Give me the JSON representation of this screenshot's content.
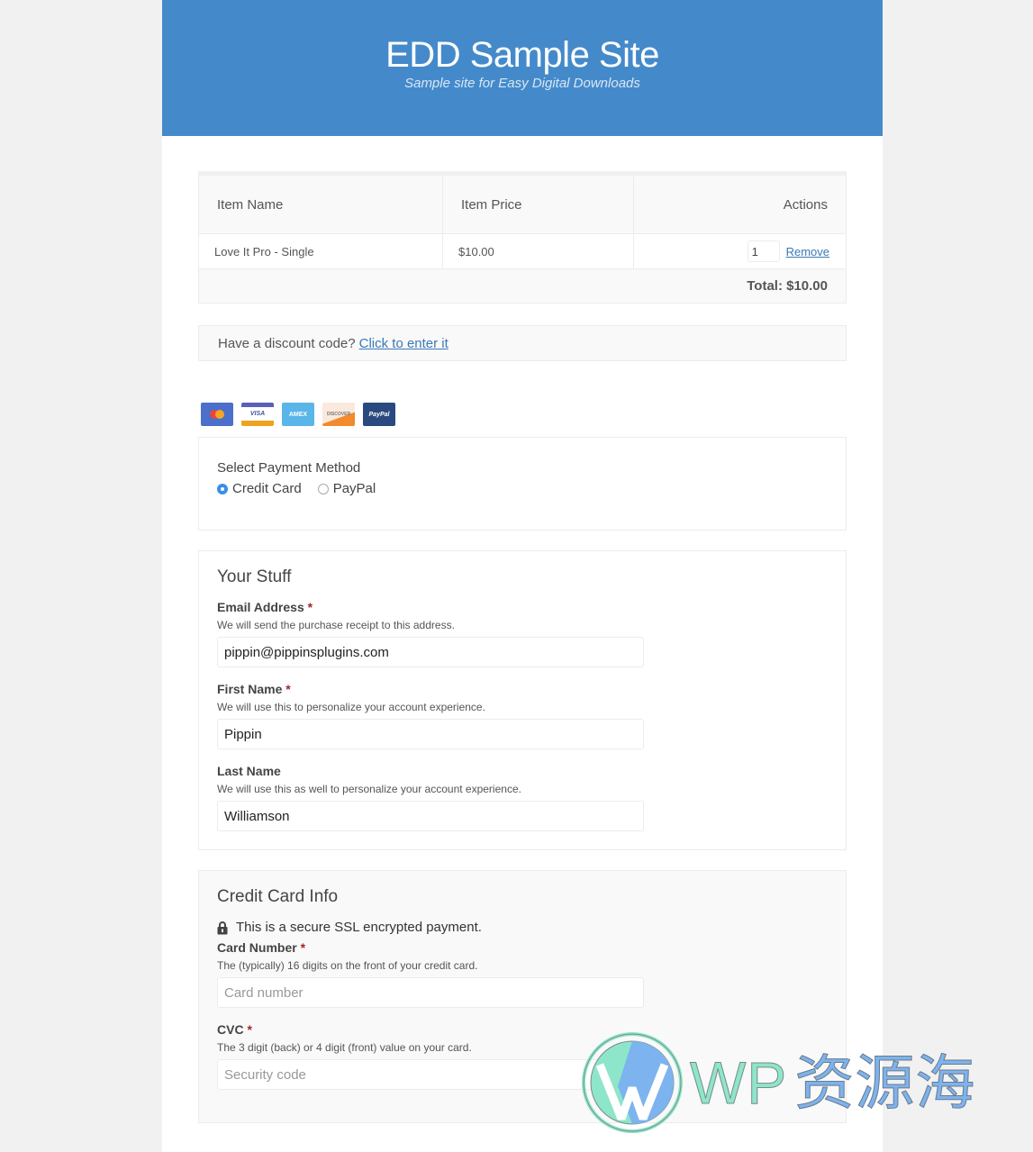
{
  "header": {
    "site_title": "EDD Sample Site",
    "site_description": "Sample site for Easy Digital Downloads",
    "color": "#448acb"
  },
  "cart": {
    "columns": [
      "Item Name",
      "Item Price",
      "Actions"
    ],
    "items": [
      {
        "name": "Love It Pro - Single",
        "price": "$10.00",
        "quantity": "1",
        "remove_label": "Remove"
      }
    ],
    "total_label": "Total: $10.00"
  },
  "discount": {
    "prompt": "Have a discount code?",
    "link_label": "Click to enter it"
  },
  "payment_icons": [
    "mastercard-icon",
    "visa-icon",
    "amex-icon",
    "discover-icon",
    "paypal-icon"
  ],
  "payment_icon_labels": {
    "visa": "VISA",
    "amex": "AMEX",
    "discover": "DISCOVER",
    "paypal": "PayPal"
  },
  "payment_method": {
    "title": "Select Payment Method",
    "options": [
      {
        "label": "Credit Card",
        "selected": true
      },
      {
        "label": "PayPal",
        "selected": false
      }
    ]
  },
  "your_stuff": {
    "legend": "Your Stuff",
    "fields": [
      {
        "label": "Email Address",
        "required": true,
        "description": "We will send the purchase receipt to this address.",
        "value": "pippin@pippinsplugins.com"
      },
      {
        "label": "First Name",
        "required": true,
        "description": "We will use this to personalize your account experience.",
        "value": "Pippin"
      },
      {
        "label": "Last Name",
        "required": false,
        "description": "We will use this as well to personalize your account experience.",
        "value": "Williamson"
      }
    ]
  },
  "credit_card": {
    "legend": "Credit Card Info",
    "ssl_notice": "This is a secure SSL encrypted payment.",
    "fields": [
      {
        "label": "Card Number",
        "required": true,
        "description": "The (typically) 16 digits on the front of your credit card.",
        "placeholder": "Card number"
      },
      {
        "label": "CVC",
        "required": true,
        "description": "The 3 digit (back) or 4 digit (front) value on your card.",
        "placeholder": "Security code"
      }
    ]
  },
  "required_marker": "*",
  "watermark": {
    "latin": "WP",
    "cjk": "资源海"
  }
}
